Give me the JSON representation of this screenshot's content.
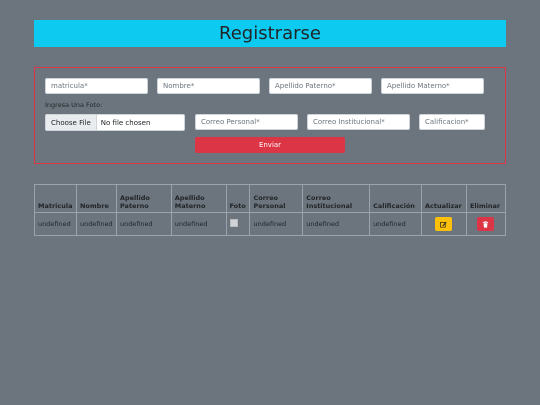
{
  "header": {
    "title": "Registrarse"
  },
  "form": {
    "matricula_placeholder": "matricula*",
    "nombre_placeholder": "Nombre*",
    "apellido_paterno_placeholder": "Apellido Paterno*",
    "apellido_materno_placeholder": "Apellido Materno*",
    "foto_label": "Ingresa Una Foto:",
    "file_button": "Choose File",
    "file_status": "No file chosen",
    "correo_personal_placeholder": "Correo Personal*",
    "correo_institucional_placeholder": "Correo Institucional*",
    "calificacion_placeholder": "Calificacion*",
    "submit_label": "Enviar"
  },
  "table": {
    "headers": [
      "Matricula",
      "Nombre",
      "Apellido Paterno",
      "Apellido Materno",
      "Foto",
      "Correo Personal",
      "Correo Institucional",
      "Calificación",
      "Actualizar",
      "Eliminar"
    ],
    "rows": [
      [
        "undefined",
        "undefined",
        "undefined",
        "undefined",
        "",
        "undefined",
        "undefined",
        "undefined"
      ]
    ]
  },
  "colors": {
    "background": "#6c757d",
    "header": "#0dcaf0",
    "danger": "#dc3545",
    "warning": "#ffc107"
  },
  "icons": {
    "edit": "pencil-square-icon",
    "delete": "trash-icon"
  }
}
